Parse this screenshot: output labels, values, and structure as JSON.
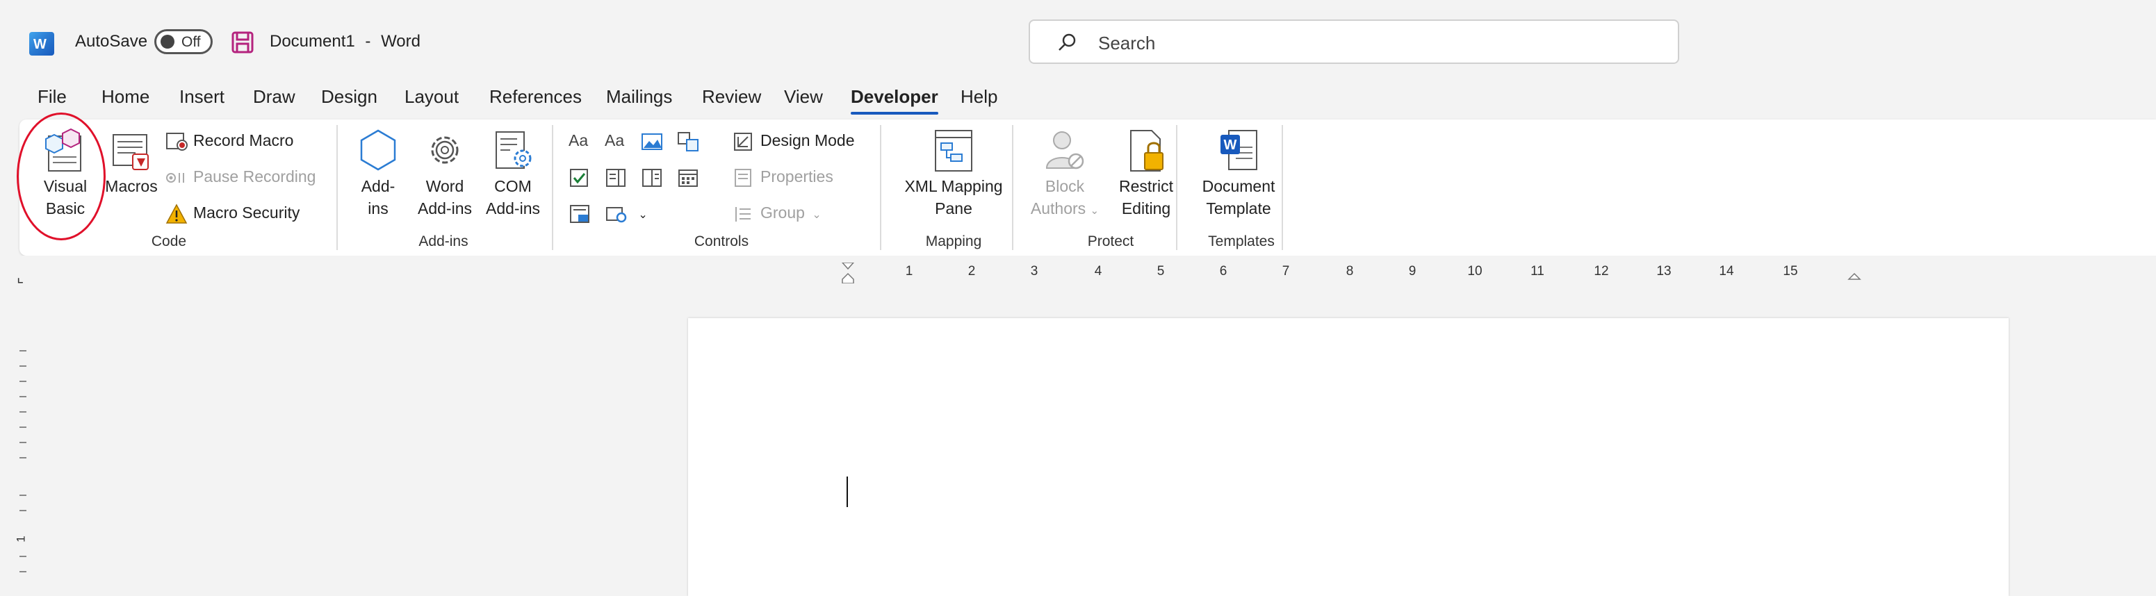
{
  "titlebar": {
    "app_icon": "word-logo-icon",
    "autosave_label": "AutoSave",
    "autosave_state": "Off",
    "document_title": "Document1",
    "separator": "-",
    "app_name": "Word"
  },
  "search": {
    "placeholder": "Search"
  },
  "tabs": [
    {
      "label": "File"
    },
    {
      "label": "Home"
    },
    {
      "label": "Insert"
    },
    {
      "label": "Draw"
    },
    {
      "label": "Design"
    },
    {
      "label": "Layout"
    },
    {
      "label": "References"
    },
    {
      "label": "Mailings"
    },
    {
      "label": "Review"
    },
    {
      "label": "View"
    },
    {
      "label": "Developer",
      "active": true
    },
    {
      "label": "Help"
    }
  ],
  "ribbon": {
    "code": {
      "group_label": "Code",
      "visual_basic": [
        "Visual",
        "Basic"
      ],
      "macros": "Macros",
      "record_macro": "Record Macro",
      "pause_recording": "Pause Recording",
      "macro_security": "Macro Security"
    },
    "addins": {
      "group_label": "Add-ins",
      "addins": [
        "Add-",
        "ins"
      ],
      "word_addins": [
        "Word",
        "Add-ins"
      ],
      "com_addins": [
        "COM",
        "Add-ins"
      ]
    },
    "controls": {
      "group_label": "Controls",
      "design_mode": "Design Mode",
      "properties": "Properties",
      "group": "Group"
    },
    "mapping": {
      "group_label": "Mapping",
      "xml_mapping_pane": [
        "XML Mapping",
        "Pane"
      ]
    },
    "protect": {
      "group_label": "Protect",
      "block_authors": [
        "Block",
        "Authors"
      ],
      "restrict_editing": [
        "Restrict",
        "Editing"
      ]
    },
    "templates": {
      "group_label": "Templates",
      "document_template": [
        "Document",
        "Template"
      ]
    }
  },
  "ruler": {
    "numbers": [
      "1",
      "2",
      "3",
      "4",
      "5",
      "6",
      "7",
      "8",
      "9",
      "10",
      "11",
      "12",
      "13",
      "14",
      "15"
    ],
    "vertical_number": "1"
  },
  "colors": {
    "accent": "#185abd",
    "highlight_circle": "#e0102a",
    "warning": "#f2b200"
  }
}
